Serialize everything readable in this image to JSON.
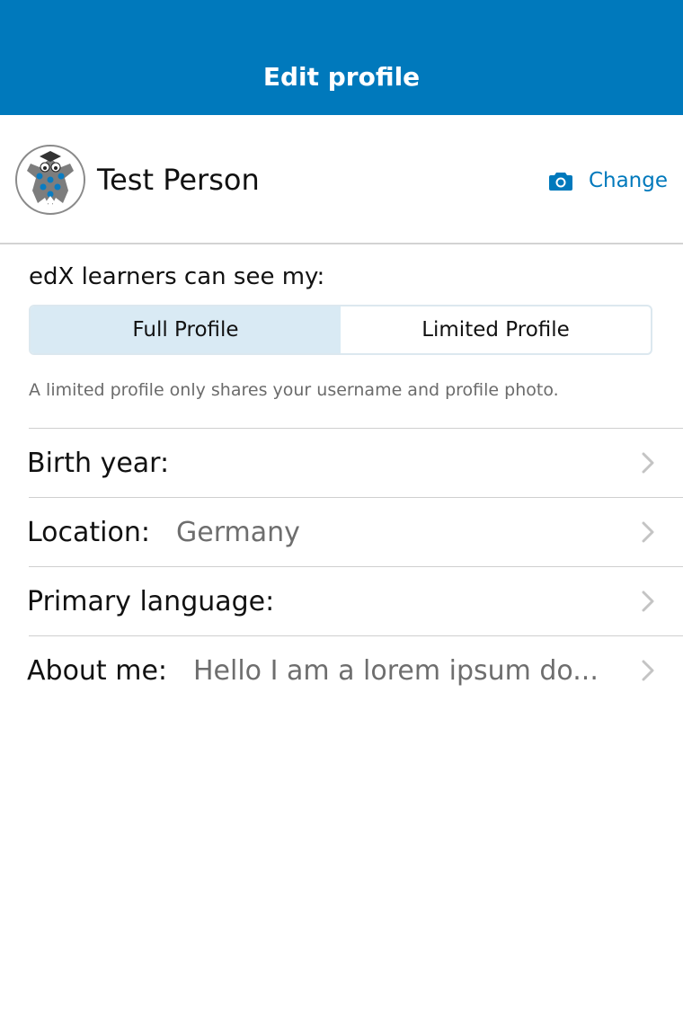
{
  "navbar": {
    "title": "Edit profile",
    "color": "#0079BC"
  },
  "profile": {
    "name": "Test Person",
    "avatar_icon": "edx-mascot-avatar",
    "change_label": "Change",
    "change_icon": "camera-icon"
  },
  "privacy": {
    "label": "edX learners can see my:",
    "options": [
      "Full Profile",
      "Limited Profile"
    ],
    "selected": "Full Profile",
    "help": "A limited profile only shares your username and profile photo."
  },
  "fields": [
    {
      "label": "Birth year:",
      "value": ""
    },
    {
      "label": "Location:",
      "value": "Germany"
    },
    {
      "label": "Primary language:",
      "value": ""
    },
    {
      "label": "About me:",
      "value": "Hello I am a lorem ipsum do..."
    }
  ]
}
